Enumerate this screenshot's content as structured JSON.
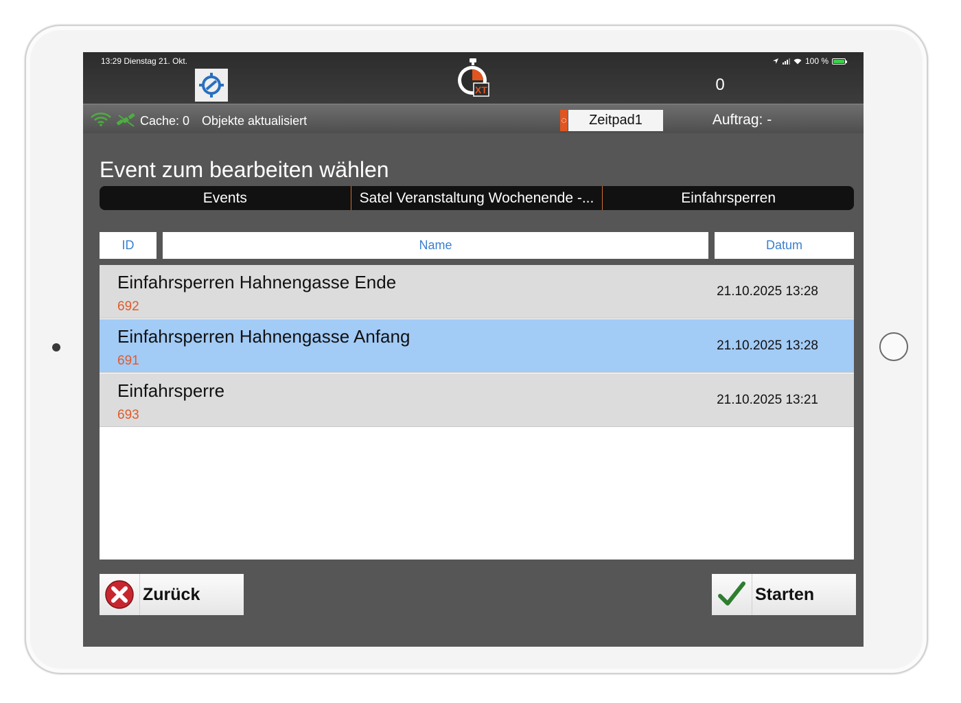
{
  "status": {
    "time_date": "13:29  Dienstag 21. Okt.",
    "battery": "100 %"
  },
  "header": {
    "counter": "0"
  },
  "infobar": {
    "cache": "Cache: 0",
    "message": "Objekte aktualisiert",
    "zeitpad": "Zeitpad1",
    "auftrag": "Auftrag: -"
  },
  "page": {
    "title": "Event zum bearbeiten wählen"
  },
  "segments": [
    "Events",
    "Satel Veranstaltung Wochenende -...",
    "Einfahrsperren"
  ],
  "columns": {
    "id": "ID",
    "name": "Name",
    "date": "Datum"
  },
  "rows": [
    {
      "name": "Einfahrsperren Hahnengasse Ende",
      "id": "692",
      "date": "21.10.2025 13:28",
      "selected": false
    },
    {
      "name": "Einfahrsperren Hahnengasse Anfang",
      "id": "691",
      "date": "21.10.2025 13:28",
      "selected": true
    },
    {
      "name": "Einfahrsperre",
      "id": "693",
      "date": "21.10.2025 13:21",
      "selected": false
    }
  ],
  "buttons": {
    "back": "Zurück",
    "start": "Starten"
  },
  "colors": {
    "row_default": "#dcdcdc",
    "row_selected": "#a2cbf6",
    "accent_orange": "#e05520",
    "link_blue": "#3a7fd0",
    "wifi_green": "#4cae3f"
  },
  "icons": {
    "location": "crosshair-icon",
    "logo": "stopwatch-xt-logo",
    "wifi": "wifi-icon",
    "satellite": "satellite-icon",
    "back": "close-circle-icon",
    "start": "checkmark-icon"
  }
}
